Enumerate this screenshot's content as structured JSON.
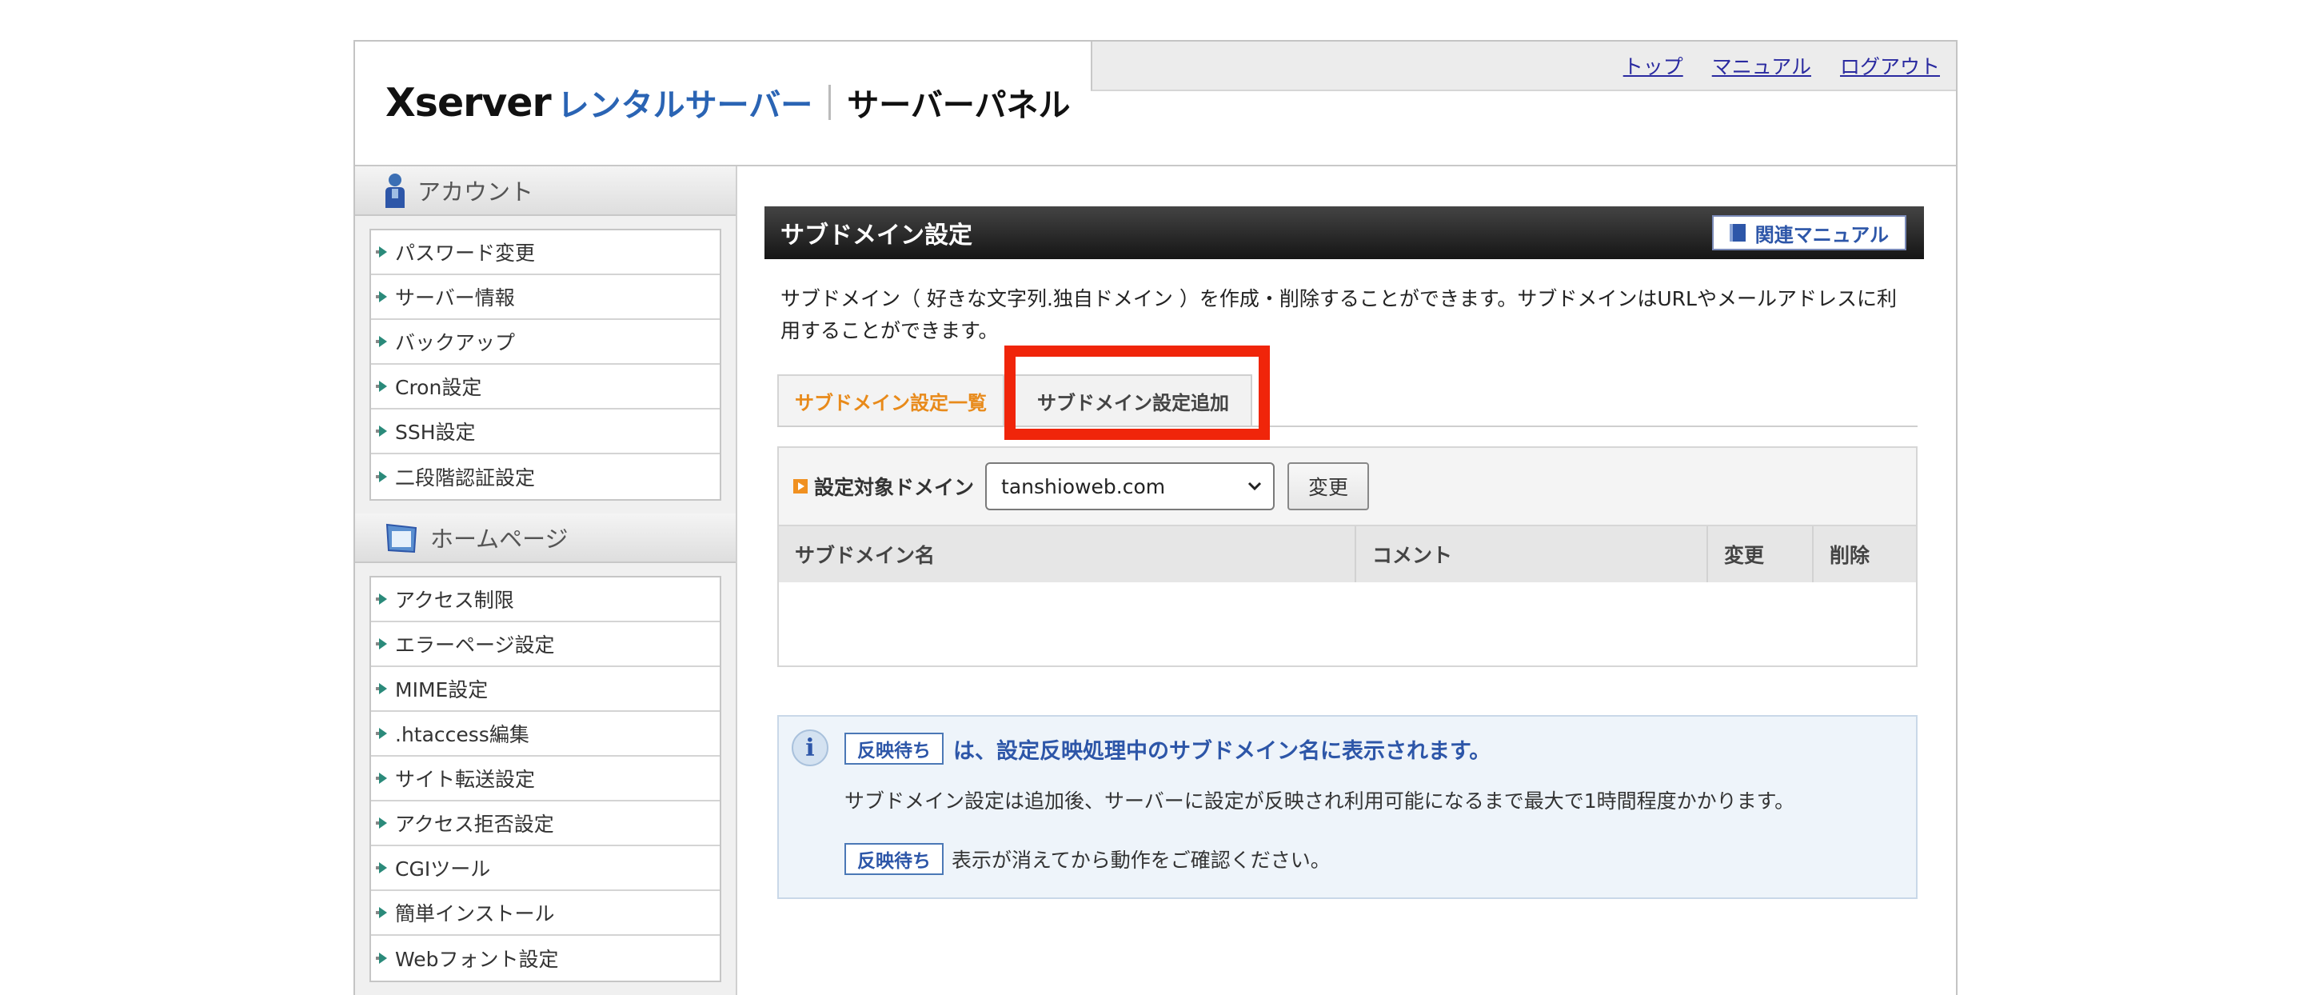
{
  "header": {
    "brand": "Xserver",
    "brand_sub": "レンタルサーバー",
    "panel_label": "サーバーパネル",
    "links": [
      "トップ",
      "マニュアル",
      "ログアウト"
    ]
  },
  "sidebar": {
    "sections": [
      {
        "title": "アカウント",
        "icon": "person-icon",
        "items": [
          "パスワード変更",
          "サーバー情報",
          "バックアップ",
          "Cron設定",
          "SSH設定",
          "二段階認証設定"
        ]
      },
      {
        "title": "ホームページ",
        "icon": "webpage-icon",
        "items": [
          "アクセス制限",
          "エラーページ設定",
          "MIME設定",
          ".htaccess編集",
          "サイト転送設定",
          "アクセス拒否設定",
          "CGIツール",
          "簡単インストール",
          "Webフォント設定"
        ]
      }
    ]
  },
  "main": {
    "title": "サブドメイン設定",
    "manual_button": "関連マニュアル",
    "description": "サブドメイン（ 好きな文字列.独自ドメイン ）を作成・削除することができます。サブドメインはURLやメールアドレスに利用することができます。",
    "tabs": [
      "サブドメイン設定一覧",
      "サブドメイン設定追加"
    ],
    "active_tab": "サブドメイン設定一覧",
    "highlight_color": "#f0250a",
    "filter_label": "設定対象ドメイン",
    "selected_domain": "tanshioweb.com",
    "change_button": "変更",
    "table_columns": [
      "サブドメイン名",
      "コメント",
      "変更",
      "削除"
    ],
    "table_rows": []
  },
  "info": {
    "badge": "反映待ち",
    "headline": "は、設定反映処理中のサブドメイン名に表示されます。",
    "body": "サブドメイン設定は追加後、サーバーに設定が反映され利用可能になるまで最大で1時間程度かかります。",
    "tail": "表示が消えてから動作をご確認ください。"
  }
}
